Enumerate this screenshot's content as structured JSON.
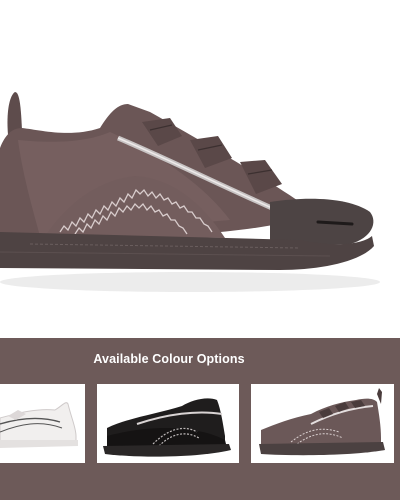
{
  "colour_section": {
    "title": "Available Colour Options",
    "options": [
      {
        "name": "white",
        "color": "#f1efee"
      },
      {
        "name": "black",
        "color": "#1f1d1d"
      },
      {
        "name": "brown",
        "color": "#6b5858"
      }
    ]
  },
  "colors": {
    "band_background": "#6d5a59",
    "hero_shoe": "#6b5656",
    "sole": "#4d4444"
  }
}
